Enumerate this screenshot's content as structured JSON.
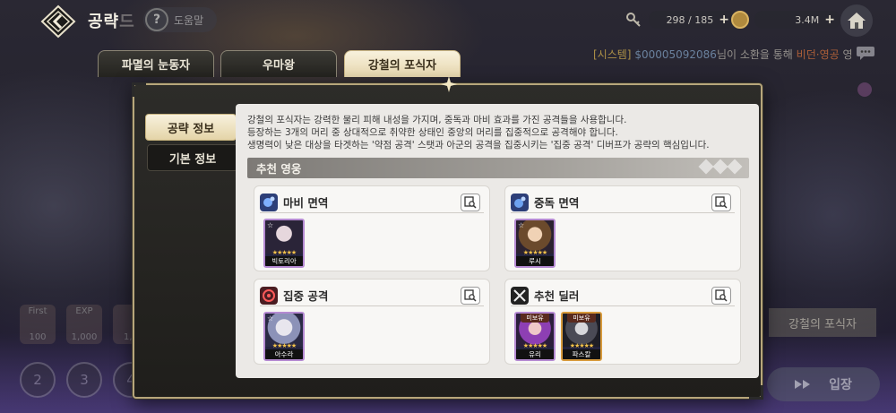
{
  "header": {
    "title": "공략",
    "title_suffix": "드",
    "help_label": "도움말",
    "keys": "298 / 185",
    "gold": "3.4M"
  },
  "notice": {
    "system_tag": "[시스템]",
    "user_id": "$00005092086",
    "text_mid": "님이 소환을 통해 ",
    "item_name": "비던·영공",
    "text_end": " 영"
  },
  "top_tabs": [
    "파멸의 눈동자",
    "우마왕",
    "강철의 포식자"
  ],
  "side_tabs": [
    "공략 정보",
    "기본 정보"
  ],
  "description": [
    "강철의 포식자는 강력한 물리 피해 내성을 가지며, 중독과 마비 효과를 가진 공격들을 사용합니다.",
    "등장하는 3개의 머리 중 상대적으로 취약한 상태인 중앙의 머리를 집중적으로 공격해야 합니다.",
    "생명력이 낮은 대상을 타겟하는 '약점 공격' 스탯과 아군의 공격을 집중시키는 '집중 공격' 디버프가 공략의 핵심입니다."
  ],
  "section_title": "추천 영웅",
  "cards": [
    {
      "title": "마비 면역",
      "icon": "paralysis-immunity-icon",
      "heroes": [
        {
          "name": "빅토리아",
          "tag": ""
        }
      ]
    },
    {
      "title": "중독 면역",
      "icon": "poison-immunity-icon",
      "heroes": [
        {
          "name": "루시",
          "tag": ""
        }
      ]
    },
    {
      "title": "집중 공격",
      "icon": "focus-attack-icon",
      "heroes": [
        {
          "name": "아수라",
          "tag": ""
        }
      ]
    },
    {
      "title": "추천 딜러",
      "icon": "swords-icon",
      "heroes": [
        {
          "name": "유리",
          "tag": "미보유"
        },
        {
          "name": "파스칼",
          "tag": "미보유"
        }
      ]
    }
  ],
  "underlay": {
    "chip_first": "First",
    "chip_first_value": "100",
    "chip_exp": "EXP",
    "chip_exp_value": "1,000",
    "chip_third_value": "1,4",
    "stages": [
      "2",
      "3",
      "4"
    ],
    "boss_name": "강철의 포식자",
    "enter_label": "입장"
  },
  "colors": {
    "accent_gold": "#e2cf98",
    "hero_purple_border": "#b58ad2",
    "hero_orange_border": "#d79a3c",
    "star": "#f3c24a"
  }
}
